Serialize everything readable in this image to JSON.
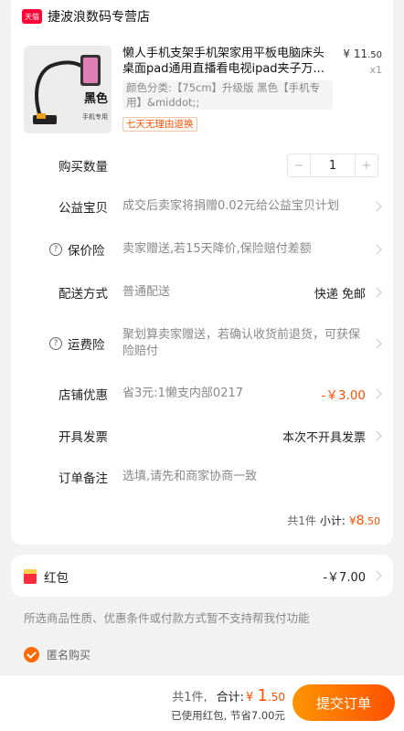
{
  "shop": {
    "badge": "天猫",
    "name": "捷波浪数码专营店"
  },
  "product": {
    "image_label": "黑色",
    "image_sub": "手机专用",
    "title": "懒人手机支架手机架家用平板电脑床头桌面pad通用直播看电视ipad夹子万...",
    "spec": "颜色分类:【75cm】升级版 黑色【手机专用】&middot;;",
    "return_tag": "七天无理由退换",
    "price_symbol": "¥",
    "price_int": "11",
    "price_frac": ".50",
    "qty": "x1"
  },
  "rows": {
    "quantity": {
      "label": "购买数量",
      "minus": "−",
      "value": "1",
      "plus": "+"
    },
    "charity": {
      "label": "公益宝贝",
      "value": "成交后卖家将捐赠0.02元给公益宝贝计划"
    },
    "price_protect": {
      "label": "保价险",
      "value": "卖家赠送,若15天降价,保险赔付差额"
    },
    "delivery": {
      "label": "配送方式",
      "value": "普通配送",
      "right": "快递 免邮"
    },
    "freight_insurance": {
      "label": "运费险",
      "value": "聚划算卖家赠送，若确认收货前退货，可获保险赔付"
    },
    "shop_discount": {
      "label": "店铺优惠",
      "value": "省3元:1懒支内部0217",
      "right": "-￥3.00"
    },
    "invoice": {
      "label": "开具发票",
      "right": "本次不开具发票"
    },
    "remark": {
      "label": "订单备注",
      "placeholder": "选填,请先和商家协商一致"
    }
  },
  "subtotal": {
    "count": "共1件",
    "label": "小计:",
    "symbol": "¥",
    "int": "8",
    "frac": ".50"
  },
  "hongbao": {
    "label": "红包",
    "value": "-￥7.00"
  },
  "notice": "所选商品性质、优惠条件或付款方式暂不支持帮我付功能",
  "anonymous": {
    "label": "匿名购买",
    "checked": true
  },
  "bottom": {
    "count": "共1件,",
    "total_label": "合计:",
    "symbol": "¥",
    "total_int": "1",
    "total_frac": ".50",
    "hongbao_note": "已使用红包, 节省7.00元",
    "submit": "提交订单"
  },
  "colors": {
    "accent": "#ff5000",
    "tmall_red": "#ff0036"
  }
}
